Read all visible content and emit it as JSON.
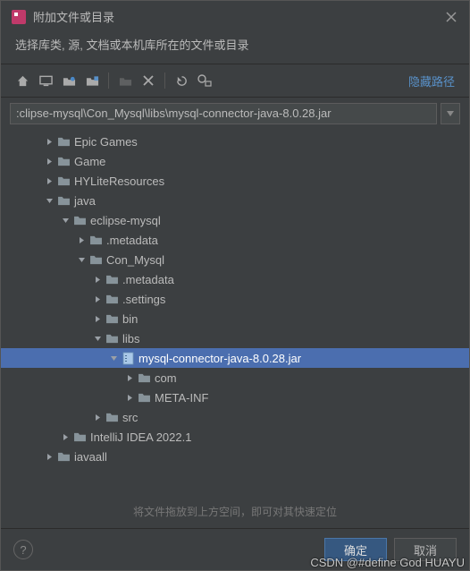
{
  "titlebar": {
    "title": "附加文件或目录"
  },
  "subtitle": "选择库类, 源, 文档或本机库所在的文件或目录",
  "toolbar": {
    "hide_path_link": "隐藏路径"
  },
  "path": {
    "value": ":clipse-mysql\\Con_Mysql\\libs\\mysql-connector-java-8.0.28.jar"
  },
  "tree": [
    {
      "indent": 2,
      "expander": "closed",
      "icon": "folder",
      "label": "Epic Games",
      "selected": false
    },
    {
      "indent": 2,
      "expander": "closed",
      "icon": "folder",
      "label": "Game",
      "selected": false
    },
    {
      "indent": 2,
      "expander": "closed",
      "icon": "folder",
      "label": "HYLiteResources",
      "selected": false
    },
    {
      "indent": 2,
      "expander": "open",
      "icon": "folder",
      "label": "java",
      "selected": false
    },
    {
      "indent": 3,
      "expander": "open",
      "icon": "folder",
      "label": "eclipse-mysql",
      "selected": false
    },
    {
      "indent": 4,
      "expander": "closed",
      "icon": "folder",
      "label": ".metadata",
      "selected": false
    },
    {
      "indent": 4,
      "expander": "open",
      "icon": "folder",
      "label": "Con_Mysql",
      "selected": false
    },
    {
      "indent": 5,
      "expander": "closed",
      "icon": "folder",
      "label": ".metadata",
      "selected": false
    },
    {
      "indent": 5,
      "expander": "closed",
      "icon": "folder",
      "label": ".settings",
      "selected": false
    },
    {
      "indent": 5,
      "expander": "closed",
      "icon": "folder",
      "label": "bin",
      "selected": false
    },
    {
      "indent": 5,
      "expander": "open",
      "icon": "folder",
      "label": "libs",
      "selected": false
    },
    {
      "indent": 6,
      "expander": "open",
      "icon": "jar",
      "label": "mysql-connector-java-8.0.28.jar",
      "selected": true
    },
    {
      "indent": 7,
      "expander": "closed",
      "icon": "folder",
      "label": "com",
      "selected": false
    },
    {
      "indent": 7,
      "expander": "closed",
      "icon": "folder",
      "label": "META-INF",
      "selected": false
    },
    {
      "indent": 5,
      "expander": "closed",
      "icon": "folder",
      "label": "src",
      "selected": false
    },
    {
      "indent": 3,
      "expander": "closed",
      "icon": "folder",
      "label": "IntelliJ IDEA 2022.1",
      "selected": false
    },
    {
      "indent": 2,
      "expander": "closed",
      "icon": "folder",
      "label": "iavaall",
      "selected": false
    }
  ],
  "hint": "将文件拖放到上方空间，即可对其快速定位",
  "footer": {
    "ok": "确定",
    "cancel": "取消"
  },
  "watermark": "CSDN @#define God HUAYU"
}
